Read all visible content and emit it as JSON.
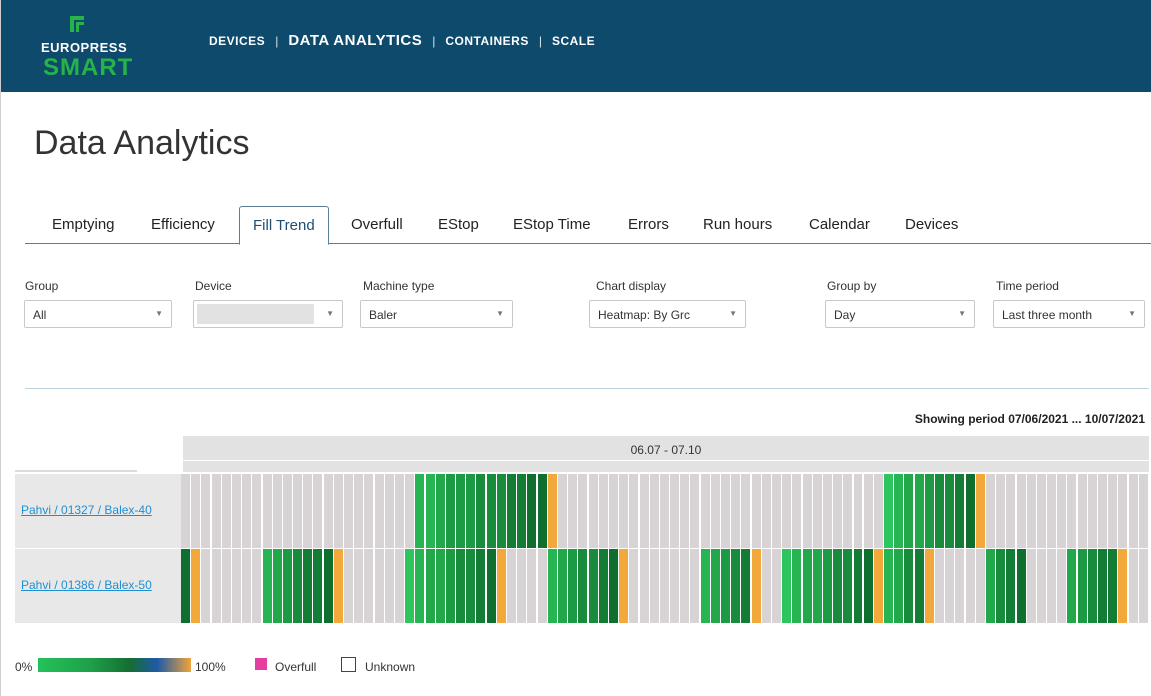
{
  "brand": {
    "top": "EUROPRESS",
    "main": "SMART"
  },
  "nav": {
    "items": [
      {
        "label": "DEVICES",
        "active": false
      },
      {
        "label": "DATA ANALYTICS",
        "active": true
      },
      {
        "label": "CONTAINERS",
        "active": false
      },
      {
        "label": "SCALE",
        "active": false
      }
    ],
    "separator": "|"
  },
  "page": {
    "title": "Data Analytics"
  },
  "tabs": [
    {
      "label": "Emptying",
      "active": false
    },
    {
      "label": "Efficiency",
      "active": false
    },
    {
      "label": "Fill Trend",
      "active": true
    },
    {
      "label": "Overfull",
      "active": false
    },
    {
      "label": "EStop",
      "active": false
    },
    {
      "label": "EStop Time",
      "active": false
    },
    {
      "label": "Errors",
      "active": false
    },
    {
      "label": "Run hours",
      "active": false
    },
    {
      "label": "Calendar",
      "active": false
    },
    {
      "label": "Devices",
      "active": false
    }
  ],
  "filters": {
    "group": {
      "label": "Group",
      "value": "All"
    },
    "device": {
      "label": "Device",
      "value": ""
    },
    "machine_type": {
      "label": "Machine type",
      "value": "Baler"
    },
    "chart_display": {
      "label": "Chart display",
      "value": "Heatmap: By Grc"
    },
    "group_by": {
      "label": "Group by",
      "value": "Day"
    },
    "time_period": {
      "label": "Time period",
      "value": "Last three month"
    }
  },
  "period": {
    "text": "Showing period 07/06/2021 ... 10/07/2021"
  },
  "heatmap": {
    "header": "06.07 - 07.10",
    "rows": [
      {
        "label": "Pahvi / 01327 / Balex-40"
      },
      {
        "label": "Pahvi / 01386 / Balex-50"
      }
    ]
  },
  "chart_data": {
    "type": "heatmap",
    "columns": 95,
    "header": "06.07 - 07.10",
    "value_scale": "0% to 100% fill; O = overfull; - = no data",
    "rows": [
      {
        "name": "Pahvi / 01327 / Balex-40",
        "values": [
          null,
          null,
          null,
          null,
          null,
          null,
          null,
          null,
          null,
          null,
          null,
          null,
          null,
          null,
          null,
          null,
          null,
          null,
          null,
          null,
          null,
          null,
          null,
          15,
          25,
          35,
          45,
          50,
          55,
          60,
          65,
          70,
          80,
          85,
          90,
          95,
          100,
          null,
          null,
          null,
          null,
          null,
          null,
          null,
          null,
          null,
          null,
          null,
          null,
          null,
          null,
          null,
          null,
          null,
          null,
          null,
          null,
          null,
          null,
          null,
          null,
          null,
          null,
          null,
          null,
          null,
          null,
          null,
          null,
          10,
          20,
          30,
          40,
          50,
          60,
          70,
          80,
          90,
          100,
          null,
          null,
          null,
          null,
          null,
          null,
          null,
          null,
          null,
          null,
          null,
          null,
          null,
          null,
          null,
          null,
          null,
          null,
          null,
          null,
          null,
          null,
          null
        ]
      },
      {
        "name": "Pahvi / 01386 / Balex-50",
        "values": [
          90,
          100,
          null,
          null,
          null,
          null,
          null,
          null,
          20,
          40,
          55,
          65,
          75,
          85,
          90,
          100,
          null,
          null,
          null,
          null,
          null,
          null,
          10,
          20,
          30,
          40,
          50,
          60,
          70,
          80,
          90,
          100,
          null,
          null,
          null,
          null,
          15,
          30,
          45,
          60,
          70,
          80,
          90,
          100,
          null,
          null,
          null,
          null,
          null,
          null,
          null,
          25,
          40,
          55,
          70,
          85,
          100,
          null,
          null,
          10,
          20,
          30,
          40,
          50,
          60,
          70,
          80,
          90,
          100,
          20,
          40,
          60,
          80,
          100,
          null,
          null,
          null,
          null,
          null,
          40,
          60,
          80,
          90,
          null,
          null,
          null,
          null,
          30,
          45,
          60,
          75,
          85,
          100,
          null
        ]
      }
    ]
  },
  "legend": {
    "min": "0%",
    "max": "100%",
    "overfull": "Overfull",
    "unknown": "Unknown"
  },
  "colors": {
    "header_bg": "#0d4a6b",
    "brand_green": "#26b34a",
    "empty_cell": "#d8d4d6",
    "overfull": "#f2a83a",
    "link": "#1f8fd3"
  }
}
